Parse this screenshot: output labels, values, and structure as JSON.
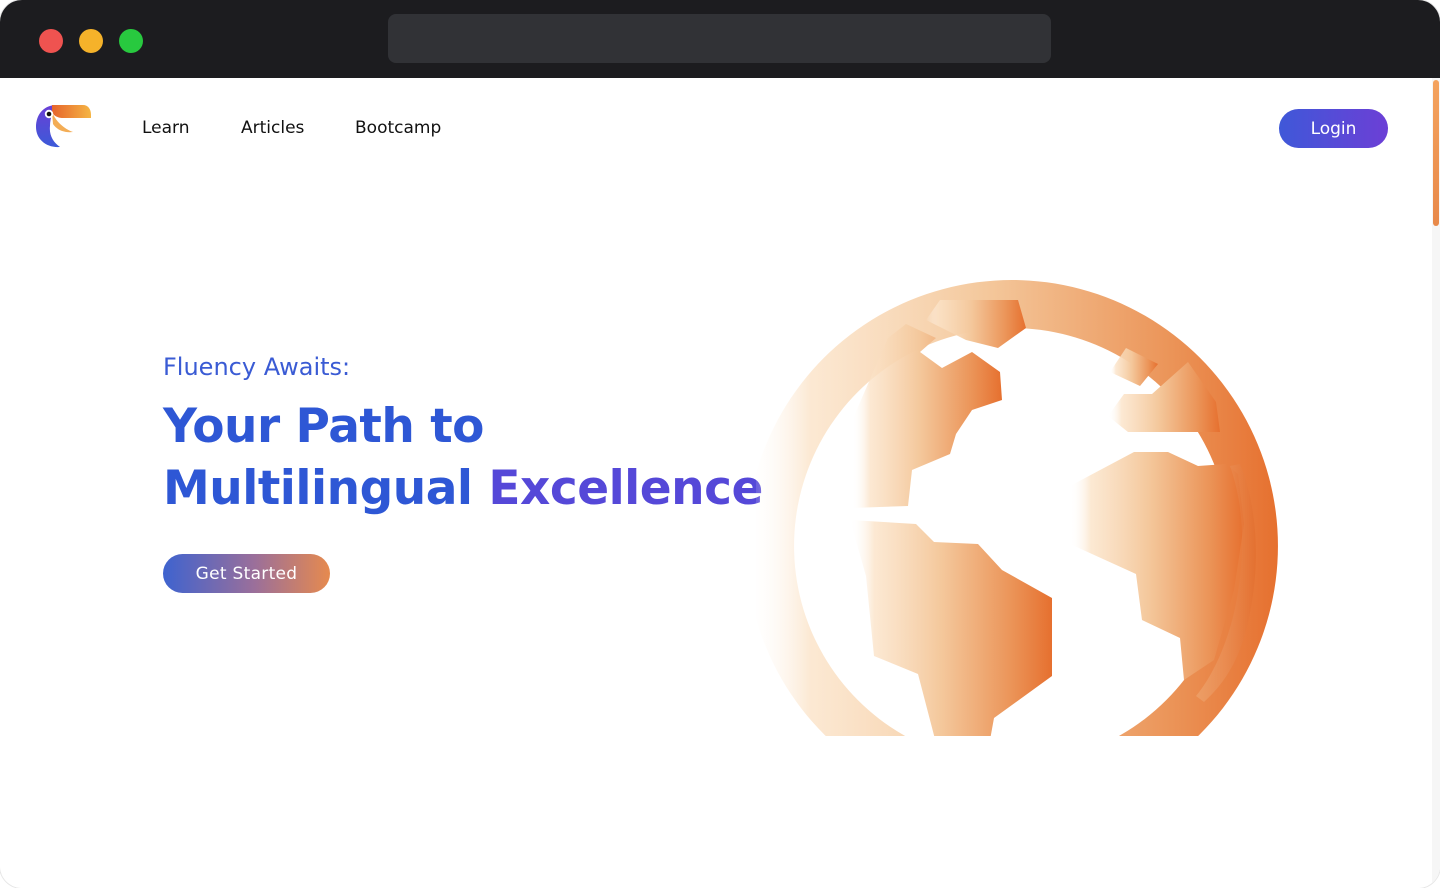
{
  "nav": {
    "logo_icon": "toucan-logo-icon",
    "links": [
      {
        "label": "Learn"
      },
      {
        "label": "Articles"
      },
      {
        "label": "Bootcamp"
      }
    ],
    "login_label": "Login"
  },
  "hero": {
    "eyebrow": "Fluency Awaits:",
    "headline_line1": "Your Path to",
    "headline_line2_part1": "Multilingual",
    "headline_line2_part2": "Excellence",
    "cta_label": "Get Started",
    "illustration_icon": "globe-icon"
  },
  "colors": {
    "brand_blue": "#2e57d5",
    "brand_purple": "#6c3fd6",
    "accent_orange": "#e8783a",
    "titlebar": "#1c1c1f"
  }
}
